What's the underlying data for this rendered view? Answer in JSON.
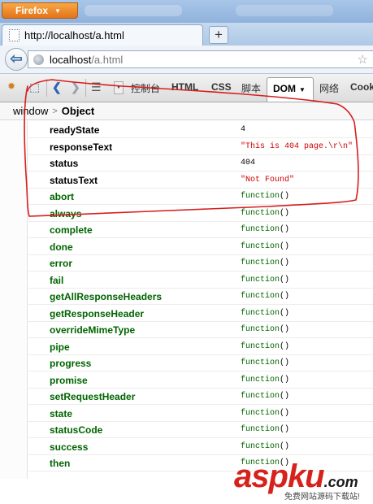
{
  "browser": {
    "app_button": "Firefox",
    "tab_title": "http://localhost/a.html",
    "new_tab": "+",
    "url_host": "localhost",
    "url_path": "/a.html"
  },
  "firebug": {
    "tabs": {
      "console": "控制台",
      "html": "HTML",
      "css": "CSS",
      "script": "脚本",
      "dom": "DOM",
      "net": "网络",
      "cookies": "Cook"
    },
    "breadcrumb": {
      "root": "window",
      "separator": ">",
      "current": "Object"
    }
  },
  "dom_rows": [
    {
      "name": "readyState",
      "value": "4",
      "kind": "number"
    },
    {
      "name": "responseText",
      "value": "\"This is 404 page.\\r\\n\"",
      "kind": "string"
    },
    {
      "name": "status",
      "value": "404",
      "kind": "number"
    },
    {
      "name": "statusText",
      "value": "\"Not Found\"",
      "kind": "string"
    },
    {
      "name": "abort",
      "value": "function",
      "kind": "function"
    },
    {
      "name": "always",
      "value": "function",
      "kind": "function"
    },
    {
      "name": "complete",
      "value": "function",
      "kind": "function"
    },
    {
      "name": "done",
      "value": "function",
      "kind": "function"
    },
    {
      "name": "error",
      "value": "function",
      "kind": "function"
    },
    {
      "name": "fail",
      "value": "function",
      "kind": "function"
    },
    {
      "name": "getAllResponseHeaders",
      "value": "function",
      "kind": "function"
    },
    {
      "name": "getResponseHeader",
      "value": "function",
      "kind": "function"
    },
    {
      "name": "overrideMimeType",
      "value": "function",
      "kind": "function"
    },
    {
      "name": "pipe",
      "value": "function",
      "kind": "function"
    },
    {
      "name": "progress",
      "value": "function",
      "kind": "function"
    },
    {
      "name": "promise",
      "value": "function",
      "kind": "function"
    },
    {
      "name": "setRequestHeader",
      "value": "function",
      "kind": "function"
    },
    {
      "name": "state",
      "value": "function",
      "kind": "function"
    },
    {
      "name": "statusCode",
      "value": "function",
      "kind": "function"
    },
    {
      "name": "success",
      "value": "function",
      "kind": "function"
    },
    {
      "name": "then",
      "value": "function",
      "kind": "function"
    }
  ],
  "watermark": {
    "brand_a": "asp",
    "brand_b": "ku",
    "brand_c": ".com",
    "tagline": "免费网站源码下载站!"
  },
  "colors": {
    "annotation_stroke": "#d81e1e",
    "property_name": "#000000",
    "method_name": "#006400",
    "string_value": "#cc0000"
  },
  "icons": [
    "firebug-icon",
    "inspect-icon",
    "prev-icon",
    "next-icon",
    "menu-icon",
    "globe-icon",
    "star-icon",
    "back-arrow-icon"
  ]
}
